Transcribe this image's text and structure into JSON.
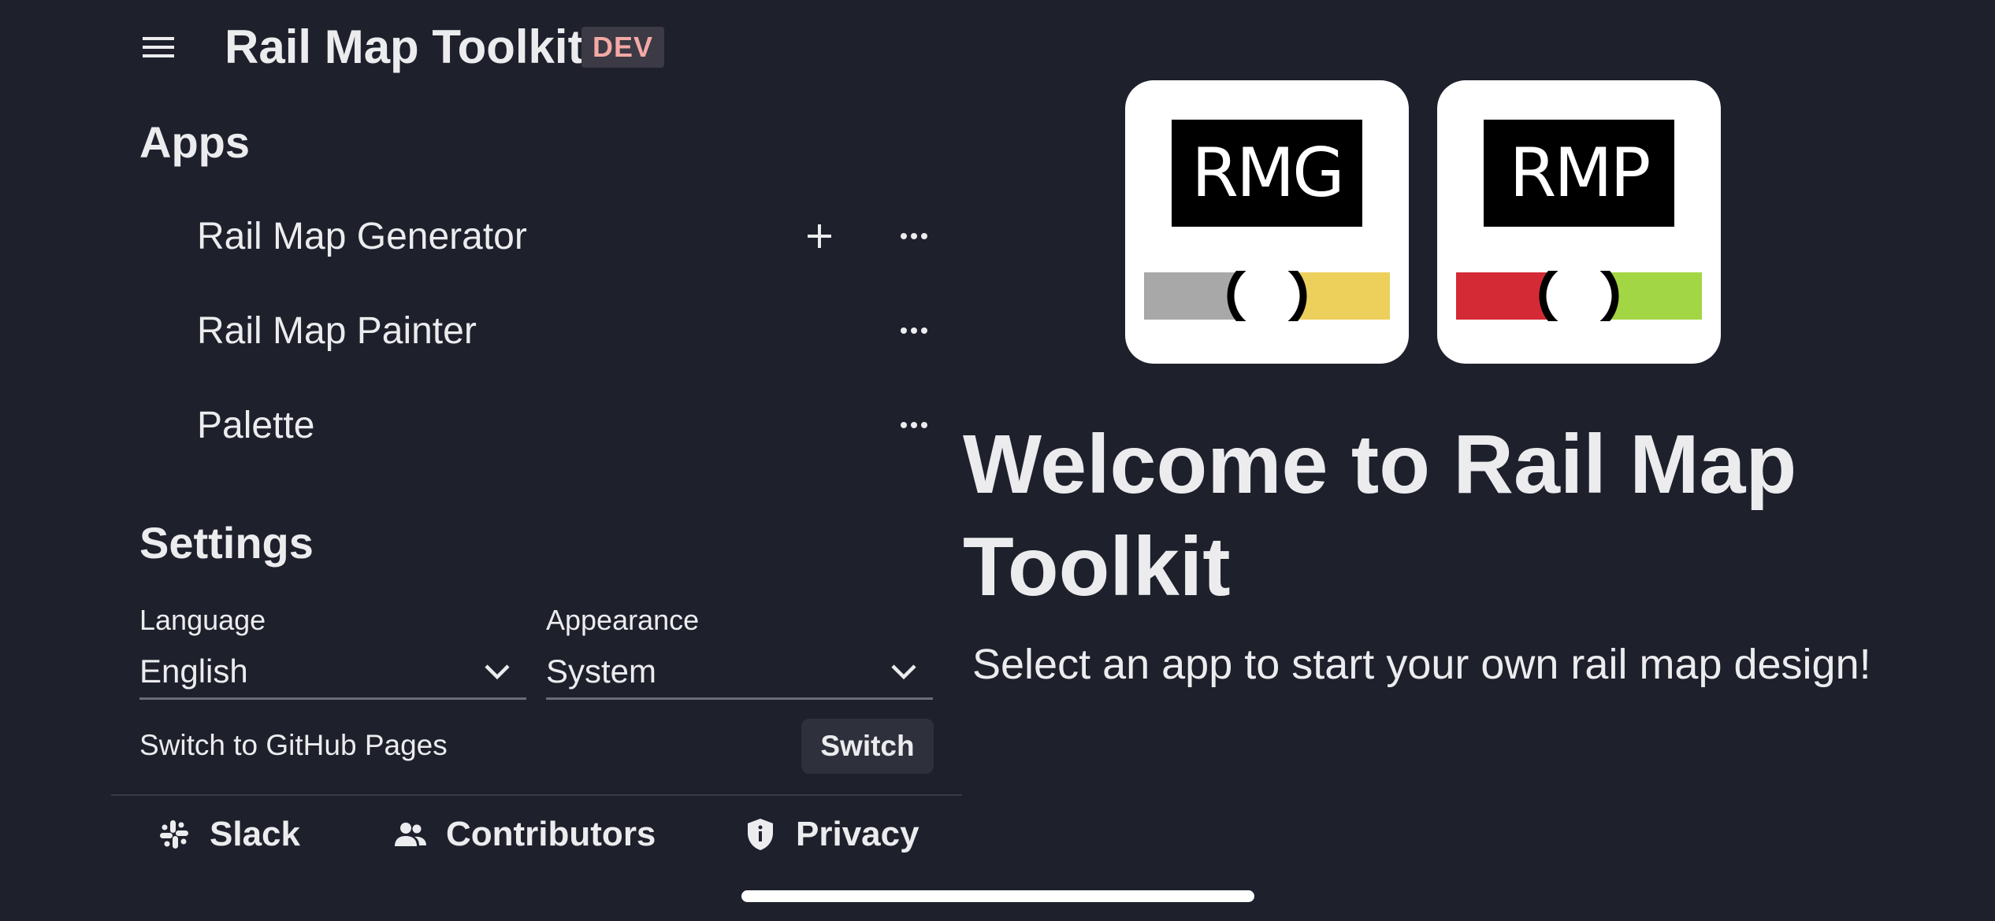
{
  "header": {
    "menu_icon": "hamburger-menu-icon",
    "title": "Rail Map Toolkit",
    "badge": "DEV"
  },
  "apps": {
    "heading": "Apps",
    "items": [
      {
        "label": "Rail Map Generator",
        "has_add": true,
        "add_icon": "plus-icon",
        "more_icon": "more-horizontal-icon"
      },
      {
        "label": "Rail Map Painter",
        "has_add": false,
        "more_icon": "more-horizontal-icon"
      },
      {
        "label": "Palette",
        "has_add": false,
        "more_icon": "more-horizontal-icon"
      }
    ]
  },
  "settings": {
    "heading": "Settings",
    "language": {
      "label": "Language",
      "value": "English",
      "icon": "chevron-down-icon"
    },
    "appearance": {
      "label": "Appearance",
      "value": "System",
      "icon": "chevron-down-icon"
    },
    "github_pages": {
      "label": "Switch to GitHub Pages",
      "button": "Switch"
    }
  },
  "footer": {
    "links": [
      {
        "label": "Slack",
        "icon": "slack-icon"
      },
      {
        "label": "Contributors",
        "icon": "people-icon"
      },
      {
        "label": "Privacy",
        "icon": "shield-icon"
      }
    ]
  },
  "main": {
    "tiles": [
      {
        "logo": "RMG",
        "track_colors": [
          "#a8a8a8",
          "#edd05c"
        ]
      },
      {
        "logo": "RMP",
        "track_colors": [
          "#d42a35",
          "#a3d645"
        ]
      }
    ],
    "title": "Welcome to Rail Map Toolkit",
    "subtitle": "Select an app to start your own rail map design!"
  },
  "colors": {
    "background": "#1e212c",
    "text": "#ececef",
    "badge_bg": "#3b3a45",
    "badge_text": "#f4a9a4",
    "button_bg": "#2e313c"
  }
}
